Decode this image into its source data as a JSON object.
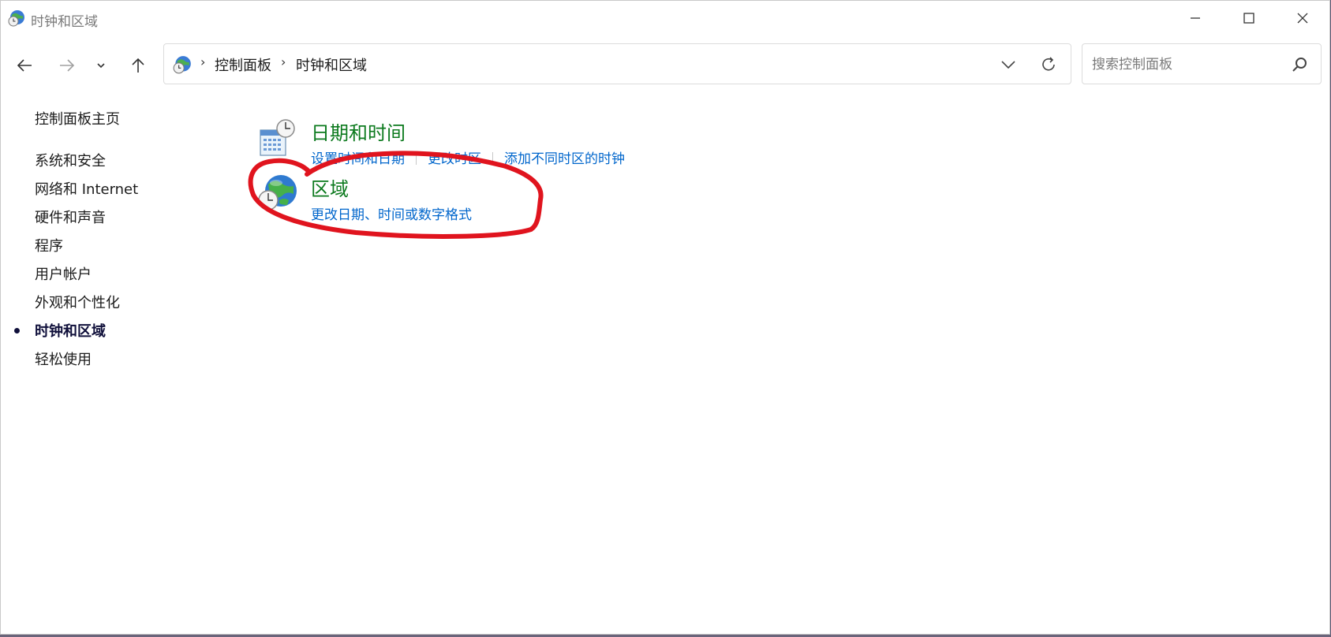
{
  "window": {
    "title": "时钟和区域",
    "minimize_icon": "minimize-icon",
    "maximize_icon": "maximize-icon",
    "close_icon": "close-icon"
  },
  "navigation": {
    "back_icon": "arrow-left-icon",
    "forward_icon": "arrow-right-icon",
    "recent_icon": "chevron-down-icon",
    "up_icon": "arrow-up-icon"
  },
  "address_bar": {
    "breadcrumbs": [
      "控制面板",
      "时钟和区域"
    ],
    "separator": "›"
  },
  "search": {
    "placeholder": "搜索控制面板"
  },
  "sidebar": {
    "home": "控制面板主页",
    "items": [
      {
        "label": "系统和安全",
        "active": false
      },
      {
        "label": "网络和 Internet",
        "active": false
      },
      {
        "label": "硬件和声音",
        "active": false
      },
      {
        "label": "程序",
        "active": false
      },
      {
        "label": "用户帐户",
        "active": false
      },
      {
        "label": "外观和个性化",
        "active": false
      },
      {
        "label": "时钟和区域",
        "active": true
      },
      {
        "label": "轻松使用",
        "active": false
      }
    ]
  },
  "categories": [
    {
      "title": "日期和时间",
      "icon": "calendar-clock-icon",
      "links": [
        "设置时间和日期",
        "更改时区",
        "添加不同时区的时钟"
      ]
    },
    {
      "title": "区域",
      "icon": "globe-clock-icon",
      "links": [
        "更改日期、时间或数字格式"
      ]
    }
  ],
  "colors": {
    "category_title": "#0c7a1e",
    "link": "#0066cc",
    "annotation": "#e0141e"
  }
}
